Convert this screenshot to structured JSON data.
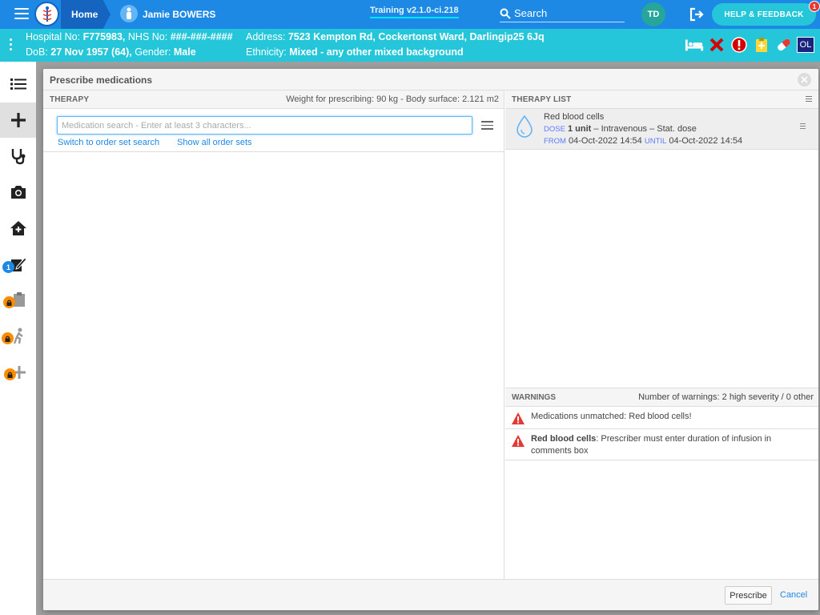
{
  "topbar": {
    "home_label": "Home",
    "patient_name": "Jamie BOWERS",
    "training_label": "Training v2.1.0-ci.218",
    "search_label": "Search",
    "user_initials": "TD",
    "help_label": "HELP & FEEDBACK",
    "help_badge": "1"
  },
  "banner": {
    "hospital_no_label": "Hospital No:",
    "hospital_no": "F775983,",
    "nhs_label": "NHS No:",
    "nhs_no": "###-###-####",
    "address_label": "Address:",
    "address": "7523 Kempton Rd, Cockertonst Ward, Darlingip25 6Jq",
    "dob_label": "DoB:",
    "dob": "27 Nov 1957 (64),",
    "gender_label": "Gender:",
    "gender": "Male",
    "ethnicity_label": "Ethnicity:",
    "ethnicity": "Mixed - any other mixed background",
    "ol_badge": "OL"
  },
  "sidenav": {
    "tasks_badge": "1"
  },
  "modal": {
    "title": "Prescribe medications",
    "therapy": {
      "header": "THERAPY",
      "weight_info": "Weight for prescribing: 90 kg - Body surface: 2.121 m2",
      "search_placeholder": "Medication search - Enter at least 3 characters...",
      "link_order_set": "Switch to order set search",
      "link_show_all": "Show all order sets"
    },
    "therapy_list": {
      "header": "THERAPY LIST",
      "items": [
        {
          "name": "Red blood cells",
          "dose_key": "DOSE",
          "dose_value": "1 unit",
          "dose_rest": " – Intravenous – Stat. dose",
          "from_key": "FROM",
          "from_value": "04-Oct-2022 14:54",
          "until_key": "UNTIL",
          "until_value": "04-Oct-2022 14:54"
        }
      ]
    },
    "warnings": {
      "header": "WARNINGS",
      "summary": "Number of warnings: 2 high severity / 0 other",
      "items": [
        {
          "bold": "",
          "text": "Medications unmatched: Red blood cells!"
        },
        {
          "bold": "Red blood cells",
          "text": ": Prescriber must enter duration of infusion in comments box"
        }
      ]
    },
    "footer": {
      "prescribe_label": "Prescribe",
      "cancel_label": "Cancel"
    }
  },
  "colors": {
    "topbar": "#1e88e5",
    "banner": "#26c6da",
    "warning_red": "#e53935",
    "lock_orange": "#fb8c00"
  }
}
